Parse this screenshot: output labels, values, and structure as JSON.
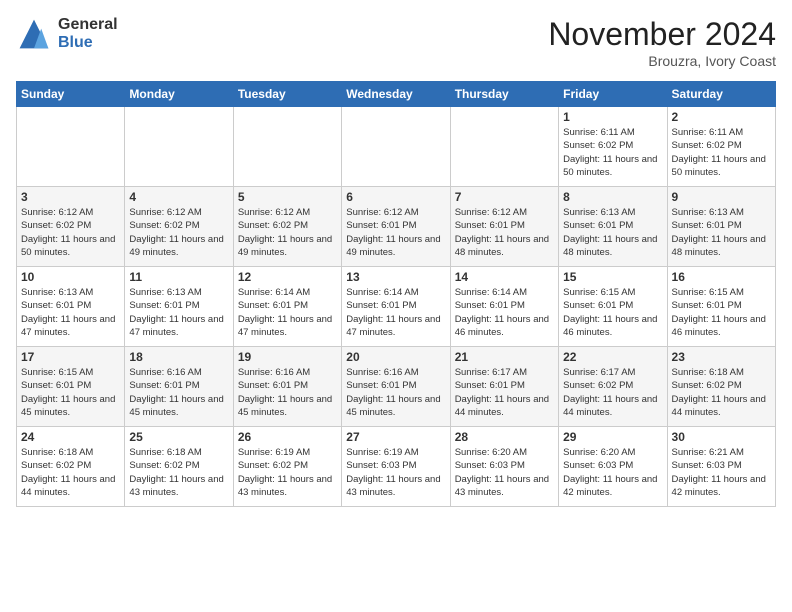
{
  "logo": {
    "general": "General",
    "blue": "Blue"
  },
  "title": "November 2024",
  "location": "Brouzra, Ivory Coast",
  "days_of_week": [
    "Sunday",
    "Monday",
    "Tuesday",
    "Wednesday",
    "Thursday",
    "Friday",
    "Saturday"
  ],
  "weeks": [
    [
      {
        "day": "",
        "info": ""
      },
      {
        "day": "",
        "info": ""
      },
      {
        "day": "",
        "info": ""
      },
      {
        "day": "",
        "info": ""
      },
      {
        "day": "",
        "info": ""
      },
      {
        "day": "1",
        "info": "Sunrise: 6:11 AM\nSunset: 6:02 PM\nDaylight: 11 hours and 50 minutes."
      },
      {
        "day": "2",
        "info": "Sunrise: 6:11 AM\nSunset: 6:02 PM\nDaylight: 11 hours and 50 minutes."
      }
    ],
    [
      {
        "day": "3",
        "info": "Sunrise: 6:12 AM\nSunset: 6:02 PM\nDaylight: 11 hours and 50 minutes."
      },
      {
        "day": "4",
        "info": "Sunrise: 6:12 AM\nSunset: 6:02 PM\nDaylight: 11 hours and 49 minutes."
      },
      {
        "day": "5",
        "info": "Sunrise: 6:12 AM\nSunset: 6:02 PM\nDaylight: 11 hours and 49 minutes."
      },
      {
        "day": "6",
        "info": "Sunrise: 6:12 AM\nSunset: 6:01 PM\nDaylight: 11 hours and 49 minutes."
      },
      {
        "day": "7",
        "info": "Sunrise: 6:12 AM\nSunset: 6:01 PM\nDaylight: 11 hours and 48 minutes."
      },
      {
        "day": "8",
        "info": "Sunrise: 6:13 AM\nSunset: 6:01 PM\nDaylight: 11 hours and 48 minutes."
      },
      {
        "day": "9",
        "info": "Sunrise: 6:13 AM\nSunset: 6:01 PM\nDaylight: 11 hours and 48 minutes."
      }
    ],
    [
      {
        "day": "10",
        "info": "Sunrise: 6:13 AM\nSunset: 6:01 PM\nDaylight: 11 hours and 47 minutes."
      },
      {
        "day": "11",
        "info": "Sunrise: 6:13 AM\nSunset: 6:01 PM\nDaylight: 11 hours and 47 minutes."
      },
      {
        "day": "12",
        "info": "Sunrise: 6:14 AM\nSunset: 6:01 PM\nDaylight: 11 hours and 47 minutes."
      },
      {
        "day": "13",
        "info": "Sunrise: 6:14 AM\nSunset: 6:01 PM\nDaylight: 11 hours and 47 minutes."
      },
      {
        "day": "14",
        "info": "Sunrise: 6:14 AM\nSunset: 6:01 PM\nDaylight: 11 hours and 46 minutes."
      },
      {
        "day": "15",
        "info": "Sunrise: 6:15 AM\nSunset: 6:01 PM\nDaylight: 11 hours and 46 minutes."
      },
      {
        "day": "16",
        "info": "Sunrise: 6:15 AM\nSunset: 6:01 PM\nDaylight: 11 hours and 46 minutes."
      }
    ],
    [
      {
        "day": "17",
        "info": "Sunrise: 6:15 AM\nSunset: 6:01 PM\nDaylight: 11 hours and 45 minutes."
      },
      {
        "day": "18",
        "info": "Sunrise: 6:16 AM\nSunset: 6:01 PM\nDaylight: 11 hours and 45 minutes."
      },
      {
        "day": "19",
        "info": "Sunrise: 6:16 AM\nSunset: 6:01 PM\nDaylight: 11 hours and 45 minutes."
      },
      {
        "day": "20",
        "info": "Sunrise: 6:16 AM\nSunset: 6:01 PM\nDaylight: 11 hours and 45 minutes."
      },
      {
        "day": "21",
        "info": "Sunrise: 6:17 AM\nSunset: 6:01 PM\nDaylight: 11 hours and 44 minutes."
      },
      {
        "day": "22",
        "info": "Sunrise: 6:17 AM\nSunset: 6:02 PM\nDaylight: 11 hours and 44 minutes."
      },
      {
        "day": "23",
        "info": "Sunrise: 6:18 AM\nSunset: 6:02 PM\nDaylight: 11 hours and 44 minutes."
      }
    ],
    [
      {
        "day": "24",
        "info": "Sunrise: 6:18 AM\nSunset: 6:02 PM\nDaylight: 11 hours and 44 minutes."
      },
      {
        "day": "25",
        "info": "Sunrise: 6:18 AM\nSunset: 6:02 PM\nDaylight: 11 hours and 43 minutes."
      },
      {
        "day": "26",
        "info": "Sunrise: 6:19 AM\nSunset: 6:02 PM\nDaylight: 11 hours and 43 minutes."
      },
      {
        "day": "27",
        "info": "Sunrise: 6:19 AM\nSunset: 6:03 PM\nDaylight: 11 hours and 43 minutes."
      },
      {
        "day": "28",
        "info": "Sunrise: 6:20 AM\nSunset: 6:03 PM\nDaylight: 11 hours and 43 minutes."
      },
      {
        "day": "29",
        "info": "Sunrise: 6:20 AM\nSunset: 6:03 PM\nDaylight: 11 hours and 42 minutes."
      },
      {
        "day": "30",
        "info": "Sunrise: 6:21 AM\nSunset: 6:03 PM\nDaylight: 11 hours and 42 minutes."
      }
    ]
  ]
}
